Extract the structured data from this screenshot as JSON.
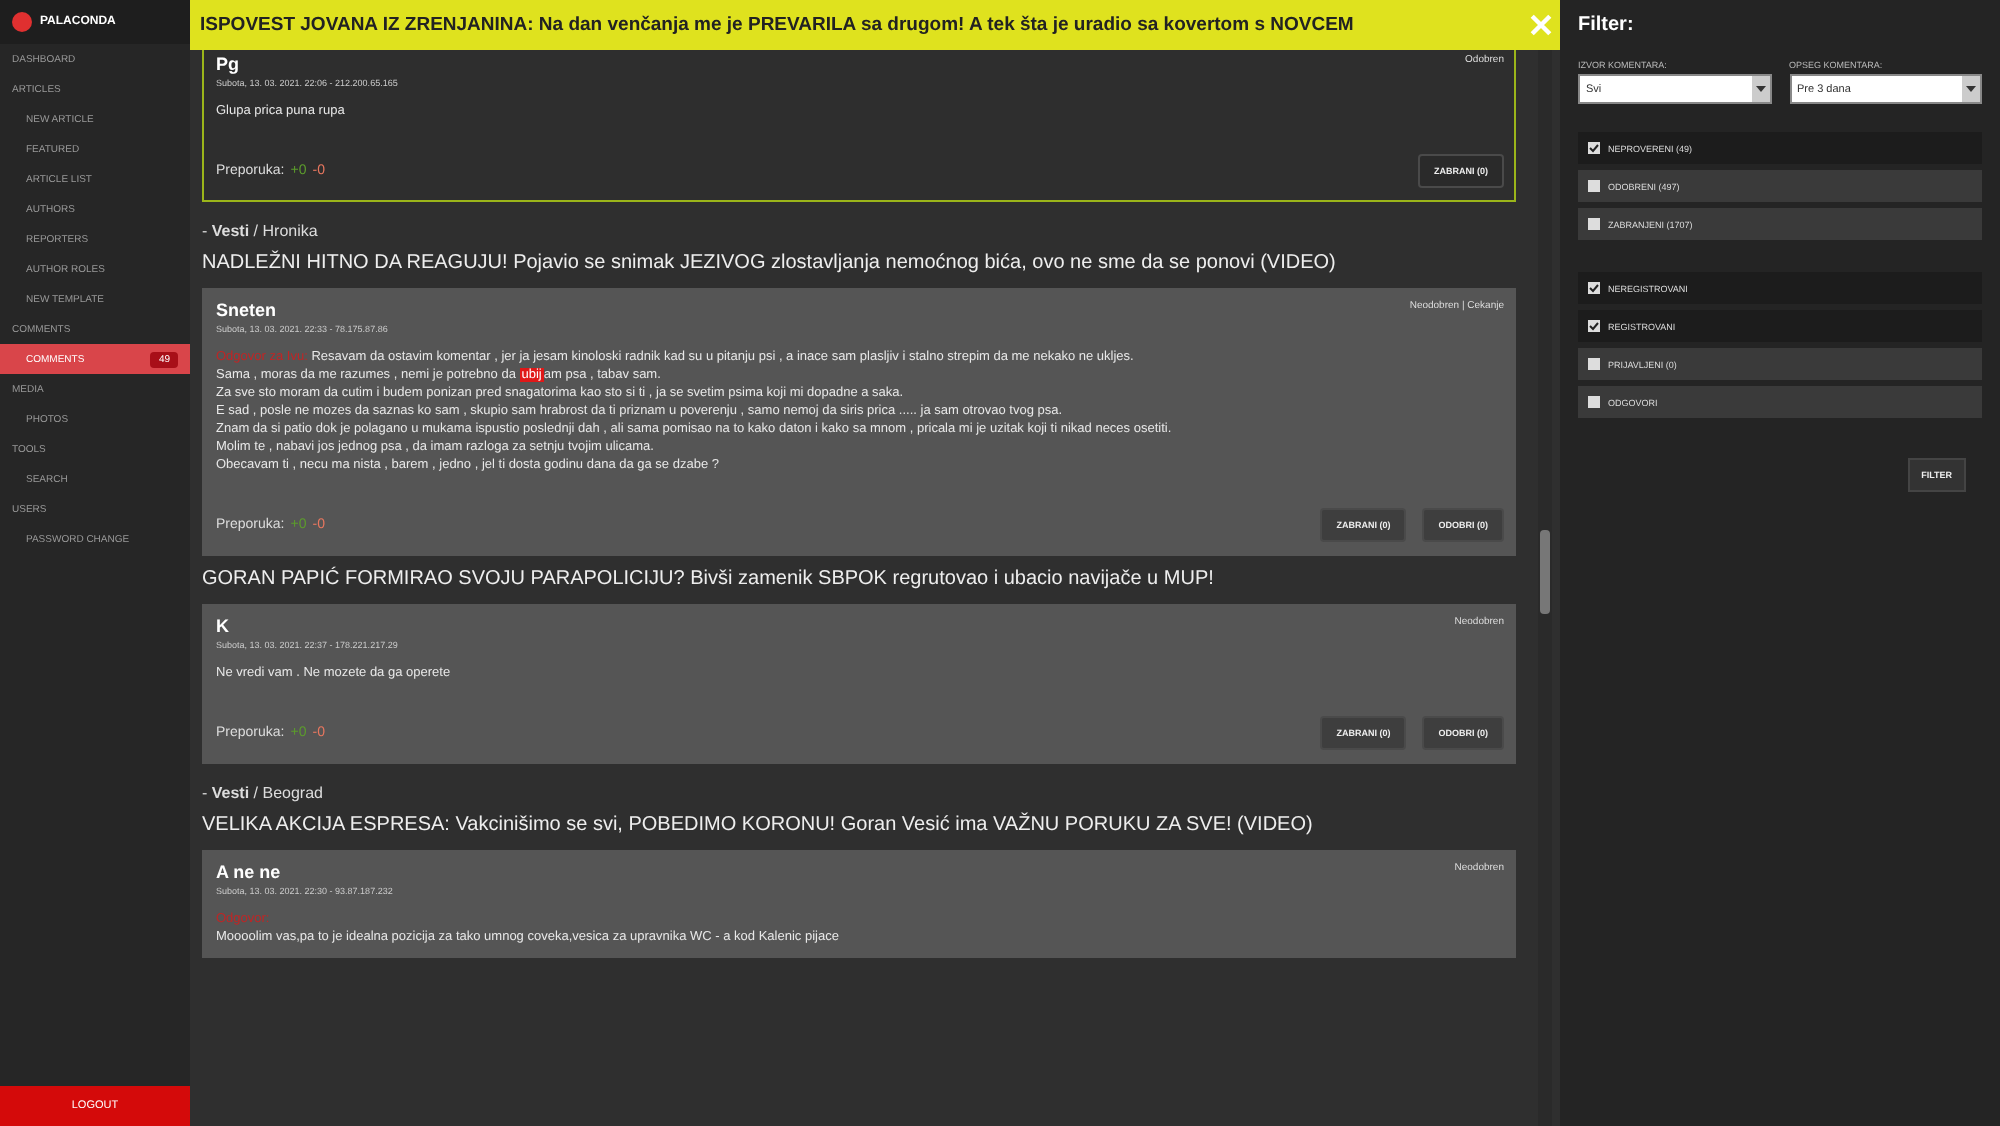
{
  "sidebar": {
    "logo": "PALACONDA",
    "items": [
      {
        "label": "DASHBOARD",
        "kind": "section",
        "selected": false
      },
      {
        "label": "ARTICLES",
        "kind": "section",
        "selected": false
      },
      {
        "label": "NEW ARTICLE",
        "kind": "item",
        "selected": false
      },
      {
        "label": "FEATURED",
        "kind": "item",
        "selected": false
      },
      {
        "label": "ARTICLE LIST",
        "kind": "item",
        "selected": false
      },
      {
        "label": "AUTHORS",
        "kind": "item",
        "selected": false
      },
      {
        "label": "REPORTERS",
        "kind": "item",
        "selected": false
      },
      {
        "label": "AUTHOR ROLES",
        "kind": "item",
        "selected": false
      },
      {
        "label": "NEW TEMPLATE",
        "kind": "item",
        "selected": false
      },
      {
        "label": "COMMENTS",
        "kind": "section",
        "selected": false
      },
      {
        "label": "COMMENTS",
        "kind": "item",
        "selected": true,
        "badge": "49"
      },
      {
        "label": "MEDIA",
        "kind": "section",
        "selected": false
      },
      {
        "label": "PHOTOS",
        "kind": "item",
        "selected": false
      },
      {
        "label": "TOOLS",
        "kind": "section",
        "selected": false
      },
      {
        "label": "SEARCH",
        "kind": "item",
        "selected": false
      },
      {
        "label": "USERS",
        "kind": "section",
        "selected": false
      },
      {
        "label": "PASSWORD CHANGE",
        "kind": "item",
        "selected": false
      }
    ],
    "logout": "LOGOUT"
  },
  "banner": {
    "text": "ISPOVEST JOVANA IZ ZRENJANINA: Na dan venčanja me je PREVARILA sa drugom! A tek šta je uradio sa kovertom s NOVCEM"
  },
  "feed": [
    {
      "kind": "comment",
      "author": "Pg",
      "meta": "Subota, 13. 03. 2021. 22:06 - 212.200.65.165",
      "status": "Odobren",
      "approved": true,
      "body": [
        [
          {
            "text": "Glupa prica puna rupa",
            "kind": "plain"
          }
        ]
      ],
      "rating_label": "Preporuka:",
      "plus": "+0",
      "minus": "-0",
      "buttons": [
        "ZABRANI (0)"
      ]
    },
    {
      "kind": "breadcrumb",
      "text": "- **Vesti** / Hronika"
    },
    {
      "kind": "headline",
      "text": "NADLEŽNI HITNO DA REAGUJU! Pojavio se snimak JEZIVOG zlostavljanja nemoćnog bića, ovo ne sme da se ponovi (VIDEO)"
    },
    {
      "kind": "comment",
      "author": "Sneten",
      "meta": "Subota, 13. 03. 2021. 22:33 - 78.175.87.86",
      "status": "Neodobren | Cekanje",
      "approved": false,
      "body": [
        [
          {
            "text": "Odgovor za Ivu:",
            "kind": "mention"
          },
          {
            "text": " Resavam da ostavim komentar , jer ja jesam kinoloski radnik kad su u pitanju psi , a inace sam plasljiv i stalno strepim da me nekako ne ukljes.",
            "kind": "plain"
          }
        ],
        [
          {
            "text": "Sama , moras da me razumes , nemi je potrebno da ",
            "kind": "plain"
          },
          {
            "text": "ubij",
            "kind": "flag"
          },
          {
            "text": "am psa , tabav sam.",
            "kind": "plain"
          }
        ],
        [
          {
            "text": "Za sve sto moram da cutim i budem ponizan pred snagatorima kao sto si ti , ja se svetim psima koji mi dopadne a saka.",
            "kind": "plain"
          }
        ],
        [
          {
            "text": "E sad , posle ne mozes da saznas ko sam , skupio sam hrabrost da ti priznam u poverenju , samo nemoj da siris prica ..... ja sam otrovao tvog psa.",
            "kind": "plain"
          }
        ],
        [
          {
            "text": "Znam da si patio dok je polagano u mukama ispustio poslednji dah , ali sama pomisao na to kako daton i kako sa mnom , pricala mi je uzitak koji ti nikad neces osetiti.",
            "kind": "plain"
          }
        ],
        [
          {
            "text": "Molim te , nabavi jos jednog psa , da imam razloga za setnju tvojim ulicama.",
            "kind": "plain"
          }
        ],
        [
          {
            "text": "Obecavam ti , necu ma nista , barem , jedno , jel ti dosta godinu dana da ga se dzabe ?",
            "kind": "plain"
          }
        ]
      ],
      "rating_label": "Preporuka:",
      "plus": "+0",
      "minus": "-0",
      "buttons": [
        "ZABRANI (0)",
        "ODOBRI (0)"
      ]
    },
    {
      "kind": "headline",
      "text": "GORAN PAPIĆ FORMIRAO SVOJU PARAPOLICIJU? Bivši zamenik SBPOK regrutovao i ubacio navijače u MUP!"
    },
    {
      "kind": "comment",
      "author": "K",
      "meta": "Subota, 13. 03. 2021. 22:37 - 178.221.217.29",
      "status": "Neodobren",
      "approved": false,
      "body": [
        [
          {
            "text": "Ne vredi vam . Ne mozete da ga operete",
            "kind": "plain"
          }
        ]
      ],
      "rating_label": "Preporuka:",
      "plus": "+0",
      "minus": "-0",
      "buttons": [
        "ZABRANI (0)",
        "ODOBRI (0)"
      ]
    },
    {
      "kind": "breadcrumb",
      "text": "- **Vesti** / Beograd"
    },
    {
      "kind": "headline",
      "text": "VELIKA AKCIJA ESPRESA: Vakcinišimo se svi, POBEDIMO KORONU! Goran Vesić ima VAŽNU PORUKU ZA SVE! (VIDEO)"
    },
    {
      "kind": "comment",
      "author": "A ne ne",
      "meta": "Subota, 13. 03. 2021. 22:30 - 93.87.187.232",
      "status": "Neodobren",
      "approved": false,
      "body": [
        [
          {
            "text": "Odgovor:",
            "kind": "mention"
          }
        ],
        [
          {
            "text": "Moooolim vas,pa to je idealna pozicija za tako umnog coveka,vesica za upravnika WC - a kod Kalenic pijace",
            "kind": "plain"
          }
        ]
      ]
    }
  ],
  "filter": {
    "title": "Filter:",
    "selects": [
      {
        "label": "IZVOR KOMENTARA:",
        "value": "Svi"
      },
      {
        "label": "OPSEG KOMENTARA:",
        "value": "Pre 3 dana"
      }
    ],
    "groups": [
      [
        {
          "label": "NEPROVERENI (49)",
          "checked": true
        },
        {
          "label": "ODOBRENI (497)",
          "checked": false
        },
        {
          "label": "ZABRANJENI (1707)",
          "checked": false
        }
      ],
      [
        {
          "label": "NEREGISTROVANI",
          "checked": true
        },
        {
          "label": "REGISTROVANI",
          "checked": true
        },
        {
          "label": "PRIJAVLJENI (0)",
          "checked": false
        },
        {
          "label": "ODGOVORI",
          "checked": false
        }
      ]
    ],
    "button": "FILTER"
  }
}
